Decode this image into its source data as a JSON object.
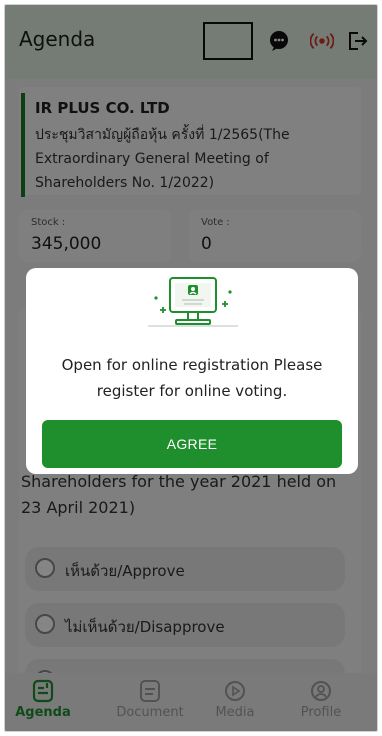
{
  "header": {
    "title": "Agenda",
    "icons": [
      "chat-icon",
      "broadcast-icon",
      "logout-icon"
    ]
  },
  "company": {
    "name": "IR PLUS CO. LTD",
    "meeting": "ประชุมวิสามัญผู้ถือหุ้น ครั้งที่ 1/2565(The Extraordinary General Meeting of Shareholders No. 1/2022)"
  },
  "stats": {
    "stock_label": "Stock :",
    "stock_value": "345,000",
    "vote_label": "Vote :",
    "vote_value": "0"
  },
  "agenda": {
    "item_text": "Shareholders for the year 2021 held on 23 April 2021)",
    "options": [
      "เห็นด้วย/Approve",
      "ไม่เห็นด้วย/Disapprove"
    ]
  },
  "modal": {
    "message": "Open for online registration Please register for online voting.",
    "button": "AGREE"
  },
  "nav": {
    "items": [
      "Agenda",
      "Document",
      "Media",
      "Profile"
    ],
    "active": "Agenda"
  },
  "colors": {
    "accent": "#1f8f2e",
    "header_bg": "#e0eee0",
    "broadcast": "#d0342c"
  }
}
